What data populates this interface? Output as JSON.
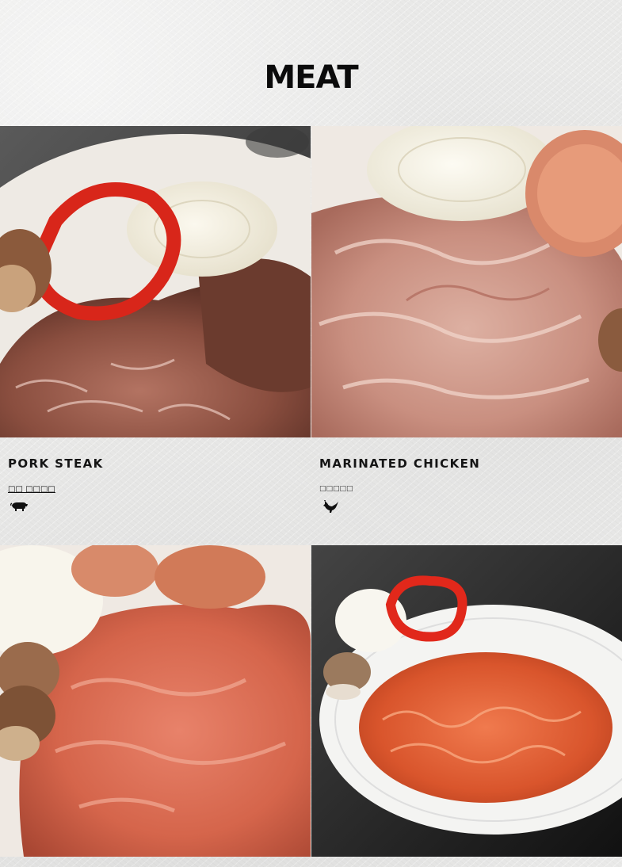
{
  "header": {
    "title": "MEAT"
  },
  "menu_items": [
    {
      "name": "PORK STEAK",
      "subtitle": "□□ □□□□",
      "animal_icon": "pig-icon"
    },
    {
      "name": "MARINATED CHICKEN",
      "subtitle": "□□□□□",
      "animal_icon": "rooster-icon"
    },
    {
      "name": "",
      "subtitle": "",
      "animal_icon": ""
    },
    {
      "name": "",
      "subtitle": "",
      "animal_icon": ""
    }
  ]
}
